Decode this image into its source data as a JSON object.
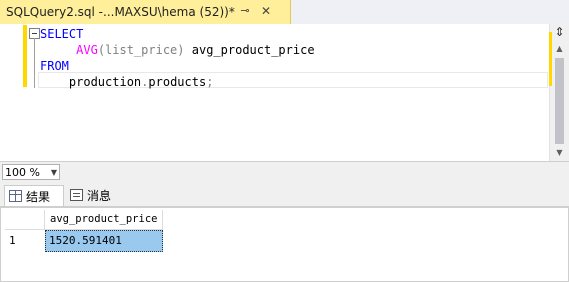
{
  "tab": {
    "title": "SQLQuery2.sql -...MAXSU\\hema (52))*",
    "pin_glyph": "⊸",
    "close_glyph": "✕"
  },
  "editor": {
    "lines": {
      "select_kw": "SELECT",
      "fn_avg": "AVG",
      "avg_args": "(list_price)",
      "avg_alias": " avg_product_price",
      "from_kw": "FROM",
      "table_schema": "production",
      "table_dot": ".",
      "table_name": "products",
      "terminator": ";"
    }
  },
  "scrollbar": {
    "split_glyph": "⇕",
    "up_glyph": "▲",
    "down_glyph": "▼"
  },
  "zoom": {
    "value": "100 %",
    "arrow": "▼"
  },
  "results_tabs": {
    "results_label": "结果",
    "messages_label": "消息"
  },
  "results_grid": {
    "columns": [
      "avg_product_price"
    ],
    "rows": [
      {
        "row_number": "1",
        "values": [
          "1520.591401"
        ]
      }
    ]
  },
  "colors": {
    "tab_active": "#ffef9a",
    "keyword": "#0000ff",
    "function": "#ff00ff",
    "selected_cell": "#99c9ef"
  }
}
